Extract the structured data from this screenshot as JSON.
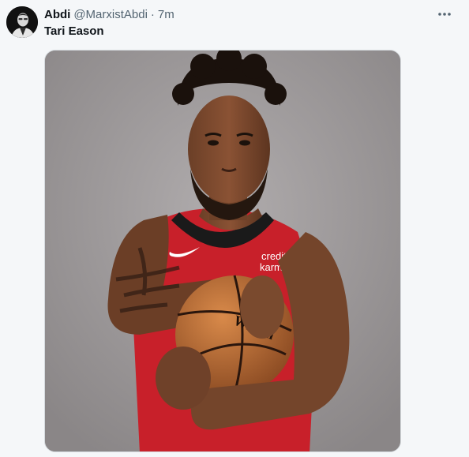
{
  "post": {
    "author_name": "Abdi",
    "author_handle": "@MarxistAbdi",
    "separator": "·",
    "time": "7m",
    "text": "Tari Eason",
    "more_icon": "more-horizontal-icon"
  },
  "media": {
    "jersey_sponsor_line1": "credit",
    "jersey_sponsor_line2": "karma",
    "ball_brand": "Wilson",
    "jersey_color": "#c8202a",
    "background_color": "#9b9798"
  }
}
